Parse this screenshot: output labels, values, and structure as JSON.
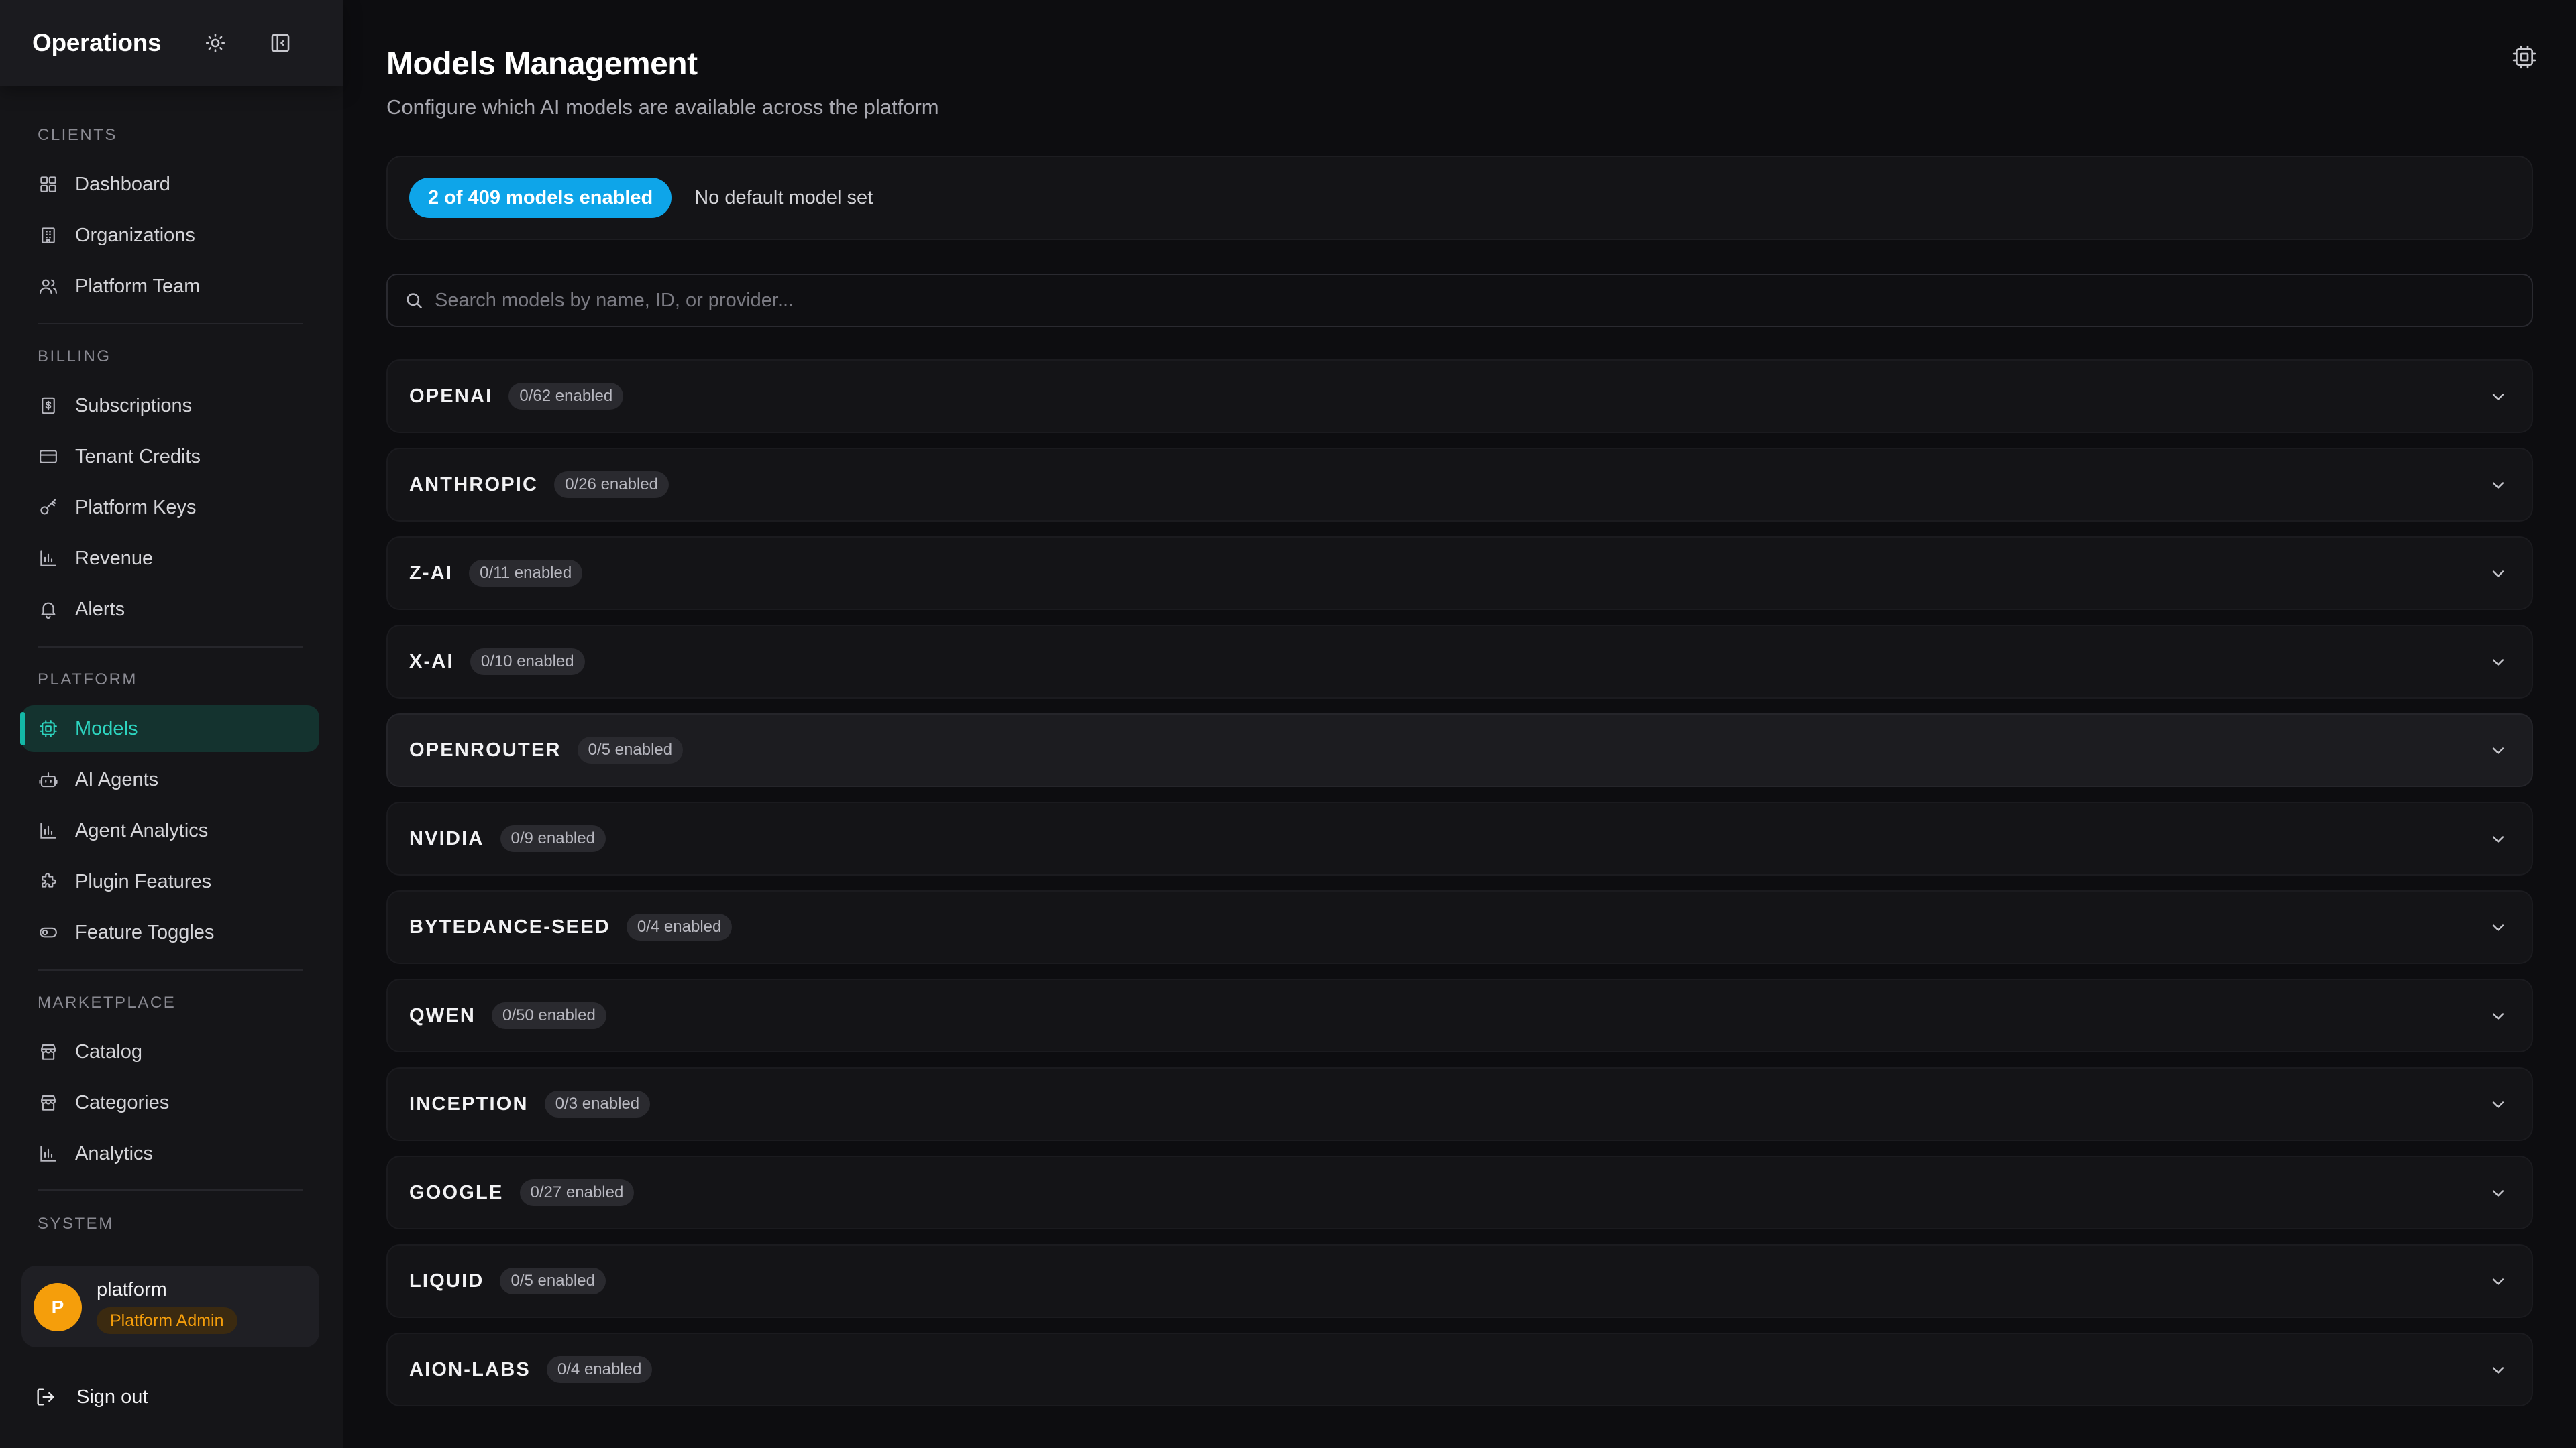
{
  "sidebar": {
    "title": "Operations",
    "sections": [
      {
        "label": "CLIENTS",
        "items": [
          {
            "label": "Dashboard",
            "icon": "grid-icon"
          },
          {
            "label": "Organizations",
            "icon": "building-icon"
          },
          {
            "label": "Platform Team",
            "icon": "users-icon"
          }
        ]
      },
      {
        "label": "BILLING",
        "items": [
          {
            "label": "Subscriptions",
            "icon": "receipt-icon"
          },
          {
            "label": "Tenant Credits",
            "icon": "credit-card-icon"
          },
          {
            "label": "Platform Keys",
            "icon": "key-icon"
          },
          {
            "label": "Revenue",
            "icon": "bar-chart-icon"
          },
          {
            "label": "Alerts",
            "icon": "bell-icon"
          }
        ]
      },
      {
        "label": "PLATFORM",
        "items": [
          {
            "label": "Models",
            "icon": "cpu-icon",
            "active": true
          },
          {
            "label": "AI Agents",
            "icon": "bot-icon"
          },
          {
            "label": "Agent Analytics",
            "icon": "bar-chart-icon"
          },
          {
            "label": "Plugin Features",
            "icon": "puzzle-icon"
          },
          {
            "label": "Feature Toggles",
            "icon": "toggle-icon"
          }
        ]
      },
      {
        "label": "MARKETPLACE",
        "items": [
          {
            "label": "Catalog",
            "icon": "store-icon"
          },
          {
            "label": "Categories",
            "icon": "store-icon"
          },
          {
            "label": "Analytics",
            "icon": "bar-chart-icon"
          }
        ]
      },
      {
        "label": "SYSTEM",
        "items": []
      }
    ],
    "user": {
      "initial": "P",
      "name": "platform",
      "role": "Platform Admin"
    },
    "sign_out": "Sign out"
  },
  "main": {
    "title": "Models Management",
    "subtitle": "Configure which AI models are available across the platform",
    "summary": {
      "enabled": "2 of 409 models enabled",
      "default_note": "No default model set"
    },
    "search": {
      "placeholder": "Search models by name, ID, or provider..."
    },
    "providers": [
      {
        "name": "OPENAI",
        "count": "0/62 enabled"
      },
      {
        "name": "ANTHROPIC",
        "count": "0/26 enabled"
      },
      {
        "name": "Z-AI",
        "count": "0/11 enabled"
      },
      {
        "name": "X-AI",
        "count": "0/10 enabled"
      },
      {
        "name": "OPENROUTER",
        "count": "0/5 enabled",
        "hover": true
      },
      {
        "name": "NVIDIA",
        "count": "0/9 enabled"
      },
      {
        "name": "BYTEDANCE-SEED",
        "count": "0/4 enabled"
      },
      {
        "name": "QWEN",
        "count": "0/50 enabled"
      },
      {
        "name": "INCEPTION",
        "count": "0/3 enabled"
      },
      {
        "name": "GOOGLE",
        "count": "0/27 enabled"
      },
      {
        "name": "LIQUID",
        "count": "0/5 enabled"
      },
      {
        "name": "AION-LABS",
        "count": "0/4 enabled"
      }
    ]
  },
  "colors": {
    "accent_teal": "#14b8a6",
    "summary_blue": "#0ea5e9",
    "admin_amber": "#f59e0b",
    "background": "#0d0d10"
  }
}
